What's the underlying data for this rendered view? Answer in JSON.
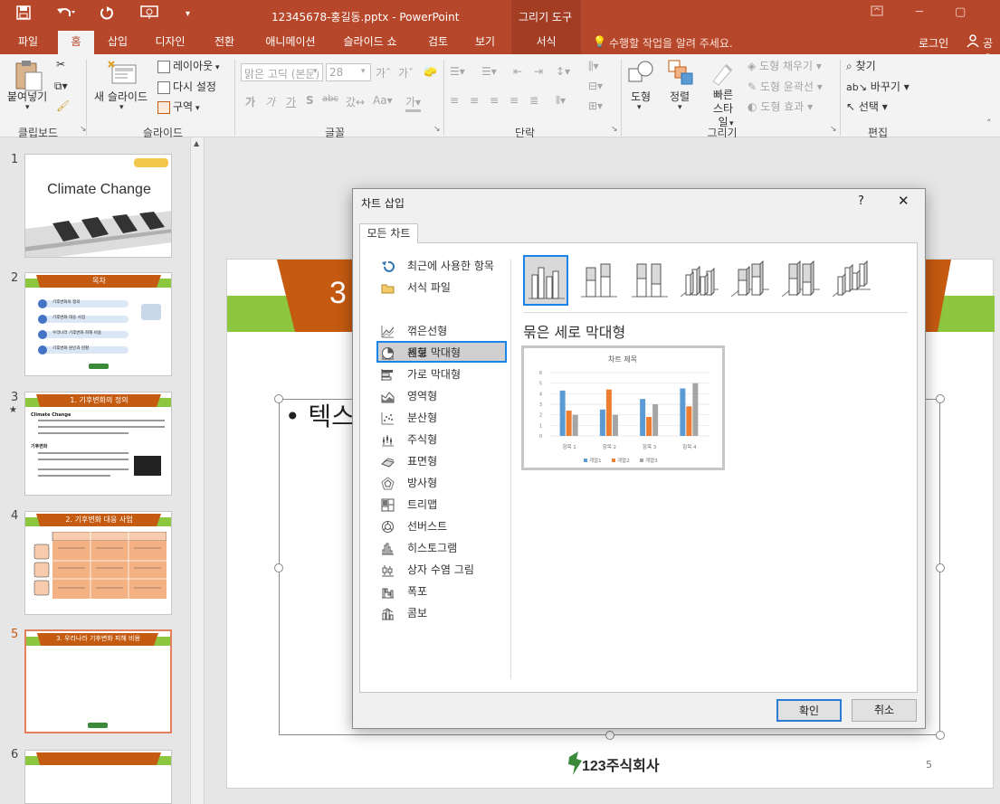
{
  "titlebar": {
    "filename": "12345678-홍길동.pptx - PowerPoint",
    "context_tab": "그리기 도구"
  },
  "tabs": [
    {
      "label": "파일"
    },
    {
      "label": "홈"
    },
    {
      "label": "삽입"
    },
    {
      "label": "디자인"
    },
    {
      "label": "전환"
    },
    {
      "label": "애니메이션"
    },
    {
      "label": "슬라이드 쇼"
    },
    {
      "label": "검토"
    },
    {
      "label": "보기"
    },
    {
      "label": "서식"
    }
  ],
  "tell_me": "수행할 작업을 알려 주세요.",
  "login": "로그인",
  "share": "공유",
  "ribbon": {
    "paste": "붙여넣기",
    "new_slide": "새 슬라이드",
    "layout": "레이아웃",
    "reset": "다시 설정",
    "section": "구역",
    "font_name": "맑은 고딕 (본문)",
    "font_size": "28",
    "shape": "도형",
    "arrange": "정렬",
    "quick_style": "빠른 스타일",
    "shape_fill": "도형 채우기",
    "shape_outline": "도형 윤곽선",
    "shape_effect": "도형 효과",
    "find": "찾기",
    "replace": "바꾸기",
    "select": "선택",
    "groups": {
      "clipboard": "클립보드",
      "slides": "슬라이드",
      "font": "글꼴",
      "paragraph": "단락",
      "drawing": "그리기",
      "editing": "편집"
    }
  },
  "slides": [
    {
      "num": "1",
      "title": "Climate Change"
    },
    {
      "num": "2",
      "title": "목차",
      "items": [
        "기후변화의 정의",
        "기후변화 대응 사업",
        "우리나라 기후변화 피해 비용",
        "기후변화 원인과 현황"
      ]
    },
    {
      "num": "3",
      "title": "1. 기후변화의 정의",
      "bullet1": "Climate Change",
      "bullet2": "기후변화"
    },
    {
      "num": "4",
      "title": "2. 기후변화 대응 사업"
    },
    {
      "num": "5",
      "title": "3. 우리나라 기후변화 피해 비용"
    },
    {
      "num": "6",
      "title": ""
    }
  ],
  "slide_main": {
    "number_prefix": "3",
    "text_prefix": "텍스",
    "page_num": "5",
    "logo_text": "123주식회사"
  },
  "dialog": {
    "title": "차트 삽입",
    "help": "?",
    "close": "✕",
    "tab": "모든 차트",
    "chart_types": [
      {
        "label": "최근에 사용한 항목",
        "icon": "recent-icon"
      },
      {
        "label": "서식 파일",
        "icon": "folder-icon"
      },
      {
        "label": "세로 막대형",
        "icon": "column-chart-icon"
      },
      {
        "label": "꺾은선형",
        "icon": "line-chart-icon"
      },
      {
        "label": "원형",
        "icon": "pie-chart-icon"
      },
      {
        "label": "가로 막대형",
        "icon": "bar-chart-icon"
      },
      {
        "label": "영역형",
        "icon": "area-chart-icon"
      },
      {
        "label": "분산형",
        "icon": "scatter-chart-icon"
      },
      {
        "label": "주식형",
        "icon": "stock-chart-icon"
      },
      {
        "label": "표면형",
        "icon": "surface-chart-icon"
      },
      {
        "label": "방사형",
        "icon": "radar-chart-icon"
      },
      {
        "label": "트리맵",
        "icon": "treemap-icon"
      },
      {
        "label": "선버스트",
        "icon": "sunburst-icon"
      },
      {
        "label": "히스토그램",
        "icon": "histogram-icon"
      },
      {
        "label": "상자 수염 그림",
        "icon": "box-whisker-icon"
      },
      {
        "label": "폭포",
        "icon": "waterfall-icon"
      },
      {
        "label": "콤보",
        "icon": "combo-icon"
      }
    ],
    "selected_subtype": "묶은 세로 막대형",
    "ok": "확인",
    "cancel": "취소"
  },
  "chart_data": {
    "type": "bar",
    "title": "차트 제목",
    "categories": [
      "항목 1",
      "항목 2",
      "항목 3",
      "항목 4"
    ],
    "series": [
      {
        "name": "계열1",
        "values": [
          4.3,
          2.5,
          3.5,
          4.5
        ],
        "color": "#5b9bd5"
      },
      {
        "name": "계열2",
        "values": [
          2.4,
          4.4,
          1.8,
          2.8
        ],
        "color": "#ed7d31"
      },
      {
        "name": "계열3",
        "values": [
          2,
          2,
          3,
          5
        ],
        "color": "#a5a5a5"
      }
    ],
    "yticks": [
      "0",
      "1",
      "2",
      "3",
      "4",
      "5",
      "6"
    ],
    "ylim": [
      0,
      6
    ],
    "legend": "bottom",
    "grid": true
  },
  "colors": {
    "accent": "#b7472a",
    "orange": "#c55a11",
    "green": "#8dc63f",
    "select_blue": "#1a85e8"
  }
}
